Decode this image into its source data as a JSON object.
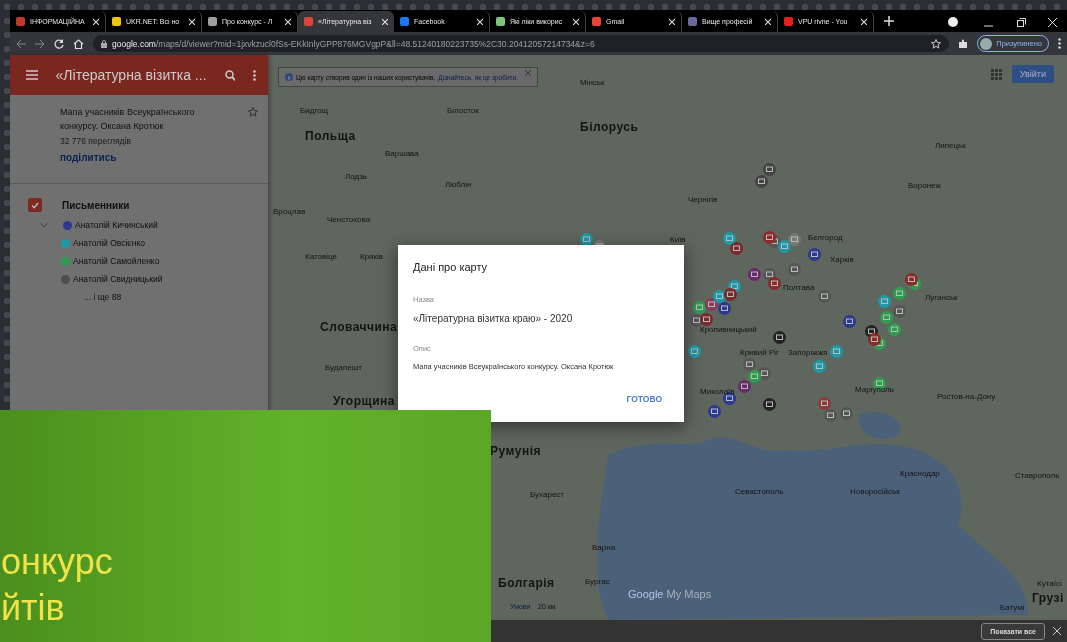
{
  "browser": {
    "tabs": [
      {
        "title": "ІНФОРМАЦІЙНА",
        "selected": false
      },
      {
        "title": "UKR.NET: Всі но",
        "selected": false
      },
      {
        "title": "Про конкурс - Л",
        "selected": false
      },
      {
        "title": "«Літературна віз",
        "selected": true
      },
      {
        "title": "Facebook",
        "selected": false
      },
      {
        "title": "Які ліки викорис",
        "selected": false
      },
      {
        "title": "Gmail",
        "selected": false
      },
      {
        "title": "Вище професій",
        "selected": false
      },
      {
        "title": "VPU rivne - You",
        "selected": false
      }
    ],
    "url_host": "google.com",
    "url_rest": "/maps/d/viewer?mid=1jxvkzucl0fSs-EKkInlyGPP876MGVgpP&ll=48.51240180223735%2C30.20412057214734&z=6",
    "profile": "Призупинено"
  },
  "panel": {
    "title": "«Літературна візитка ...",
    "description": "Мапа учасників Всеукраїнського конкурсу. Оксана Кротюк",
    "views": "32 776 переглядів",
    "share": "поділитись",
    "layer": {
      "name": "Письменники",
      "checked": true,
      "expanded": true,
      "items": [
        {
          "name": "Анатолій Кичинський",
          "color": "#2b3990"
        },
        {
          "name": "Анатолій Овсієнко",
          "color": "#1b9aaa"
        },
        {
          "name": "Анатолій Самойленко",
          "color": "#2e9e4e"
        },
        {
          "name": "Анатолій Свидницький",
          "color": "#4d4d4d"
        }
      ],
      "more": "... і ще 88"
    }
  },
  "map": {
    "banner": "Цю карту створив один із наших користувачів.",
    "banner_link": "Дізнайтесь, як це зробити.",
    "signin": "Увійти",
    "labels": [
      {
        "text": "Мінськ",
        "kind": "city"
      },
      {
        "text": "Білорусь",
        "kind": "country"
      },
      {
        "text": "Бидгощ",
        "kind": "city"
      },
      {
        "text": "Білосток",
        "kind": "city"
      },
      {
        "text": "Польща",
        "kind": "country"
      },
      {
        "text": "Варшава",
        "kind": "city"
      },
      {
        "text": "Лодзь",
        "kind": "city"
      },
      {
        "text": "Люблін",
        "kind": "city"
      },
      {
        "text": "Вроцлав",
        "kind": "city"
      },
      {
        "text": "Ченстохова",
        "kind": "city"
      },
      {
        "text": "Катовіце",
        "kind": "city"
      },
      {
        "text": "Краків",
        "kind": "city"
      },
      {
        "text": "Словаччина",
        "kind": "country"
      },
      {
        "text": "Будапешт",
        "kind": "city"
      },
      {
        "text": "Угорщина",
        "kind": "country"
      },
      {
        "text": "Румунія",
        "kind": "country"
      },
      {
        "text": "Бухарест",
        "kind": "city"
      },
      {
        "text": "Варна",
        "kind": "city"
      },
      {
        "text": "Болгарія",
        "kind": "country"
      },
      {
        "text": "Бургас",
        "kind": "city"
      },
      {
        "text": "Київ",
        "kind": "city"
      },
      {
        "text": "Чернігів",
        "kind": "city"
      },
      {
        "text": "Харків",
        "kind": "city"
      },
      {
        "text": "Бєлгород",
        "kind": "city"
      },
      {
        "text": "Воронеж",
        "kind": "city"
      },
      {
        "text": "Липецьк",
        "kind": "city"
      },
      {
        "text": "Полтава",
        "kind": "city"
      },
      {
        "text": "Луганськ",
        "kind": "city"
      },
      {
        "text": "Ростов-на-Дону",
        "kind": "city"
      },
      {
        "text": "Маріуполь",
        "kind": "city"
      },
      {
        "text": "Миколаїв",
        "kind": "city"
      },
      {
        "text": "Запоріжжя",
        "kind": "city"
      },
      {
        "text": "Кривий Ріг",
        "kind": "city"
      },
      {
        "text": "Кропивницький",
        "kind": "city"
      },
      {
        "text": "Севастополь",
        "kind": "city"
      },
      {
        "text": "Краснодар",
        "kind": "city"
      },
      {
        "text": "Ставрополь",
        "kind": "city"
      },
      {
        "text": "Новоросійськ",
        "kind": "city"
      },
      {
        "text": "Кутаїсі",
        "kind": "city"
      },
      {
        "text": "Грузі",
        "kind": "country"
      },
      {
        "text": "Батумі",
        "kind": "city"
      }
    ],
    "terms": "Умови",
    "scale": "20 км",
    "logo_google": "Google",
    "logo_suffix": "My Maps"
  },
  "dialog": {
    "title": "Дані про карту",
    "name_label": "Назва",
    "name_value": "«Літературна візитка краю» - 2020",
    "desc_label": "Опис",
    "desc_value": "Мапа учасників Всеукраїнського конкурсу. Оксана Кротюк",
    "button": "ГОТОВО"
  },
  "download_bar": {
    "button": "Показати все"
  },
  "overlay": {
    "lines": [
      "онкурс",
      "йтів"
    ]
  }
}
